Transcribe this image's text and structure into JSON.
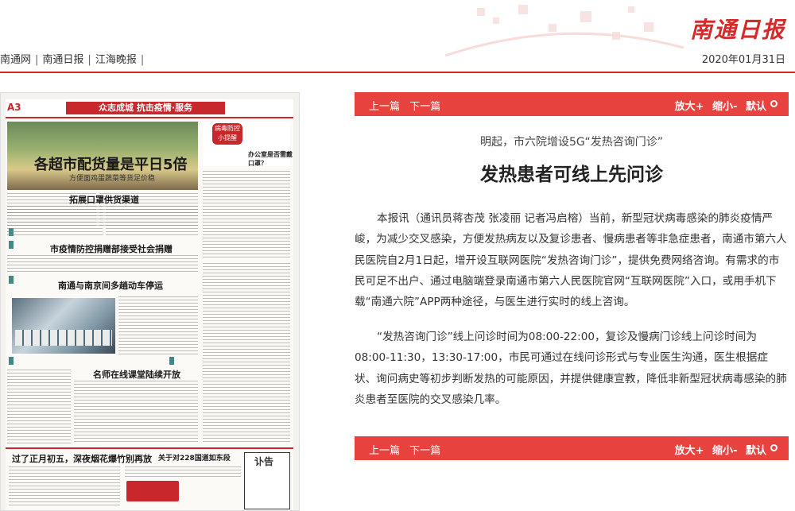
{
  "header": {
    "logo": "南通日报",
    "links": [
      "南通网",
      "南通日报",
      "江海晚报"
    ],
    "separator": "|",
    "date": "2020年01月31日"
  },
  "paper": {
    "page_no": "A3",
    "band": "众志成城 抗击疫情·服务",
    "headline_main": "各超市配货量是平日5倍",
    "headline_main_sub": "方便面鸡蛋蔬菜等货足价稳",
    "side_badge": "病毒防控小提醒",
    "side_question": "办公室是否需戴口罩？",
    "headline_2": "拓展口罩供货渠道",
    "headline_3": "市疫情防控捐赠部接受社会捐赠",
    "headline_4": "南通与南京间多趟动车停运",
    "headline_5": "名师在线课堂陆续开放",
    "headline_6": "过了正月初五，深夜烟花爆竹别再放",
    "headline_7": "关于对228国道如东段",
    "obit": "讣告"
  },
  "article": {
    "nav": {
      "prev": "上一篇",
      "next": "下一篇"
    },
    "zoom": {
      "in": "放大+",
      "out": "缩小-",
      "default": "默认"
    },
    "subtitle": "明起，市六院增设5G“发热咨询门诊”",
    "title": "发热患者可线上先问诊",
    "paragraphs": [
      "本报讯（通讯员蒋杏茂 张凌丽 记者冯启榕）当前，新型冠状病毒感染的肺炎疫情严峻，为减少交叉感染，方便发热病友以及复诊患者、慢病患者等非急症患者，南通市第六人民医院自2月1日起，增开设互联网医院“发热咨询门诊”，提供免费网络咨询。有需求的市民可足不出户、通过电脑端登录南通市第六人民医院官网“互联网医院”入口，或用手机下载“南通六院”APP两种途径，与医生进行实时的线上咨询。",
      "“发热咨询门诊”线上问诊时间为08:00-22:00，复诊及慢病门诊线上问诊时间为08:00-11:30，13:30-17:00，市民可通过在线问诊形式与专业医生沟通，医生根据症状、询问病史等初步判断发热的可能原因，并提供健康宣教，降低非新型冠状病毒感染的肺炎患者至医院的交叉感染几率。"
    ]
  },
  "colors": {
    "brand_red": "#e8423f",
    "logo_red": "#d42a2a"
  }
}
